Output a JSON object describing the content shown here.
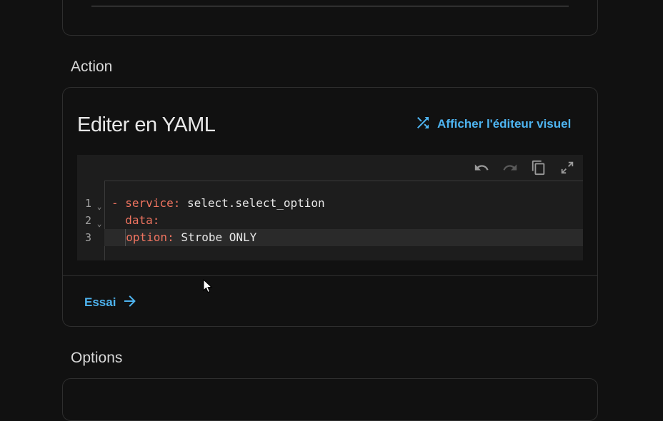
{
  "sections": {
    "action_title": "Action",
    "options_title": "Options"
  },
  "action_card": {
    "title": "Editer en YAML",
    "toggle_label": "Afficher l'éditeur visuel",
    "test_label": "Essai"
  },
  "editor": {
    "toolbar": [
      "undo-icon",
      "redo-icon",
      "copy-icon",
      "fullscreen-icon"
    ],
    "line_numbers": [
      "1",
      "2",
      "3"
    ],
    "lines": [
      {
        "dash": "- ",
        "key": "service",
        "sep": ": ",
        "value": "select.select_option"
      },
      {
        "dash": "",
        "key": "data",
        "sep": ":",
        "value": ""
      },
      {
        "dash": "",
        "key": "option",
        "sep": ": ",
        "value": "Strobe ONLY"
      }
    ]
  },
  "colors": {
    "background": "#111111",
    "accent": "#4eb4f0",
    "yaml_key": "#f07460"
  }
}
